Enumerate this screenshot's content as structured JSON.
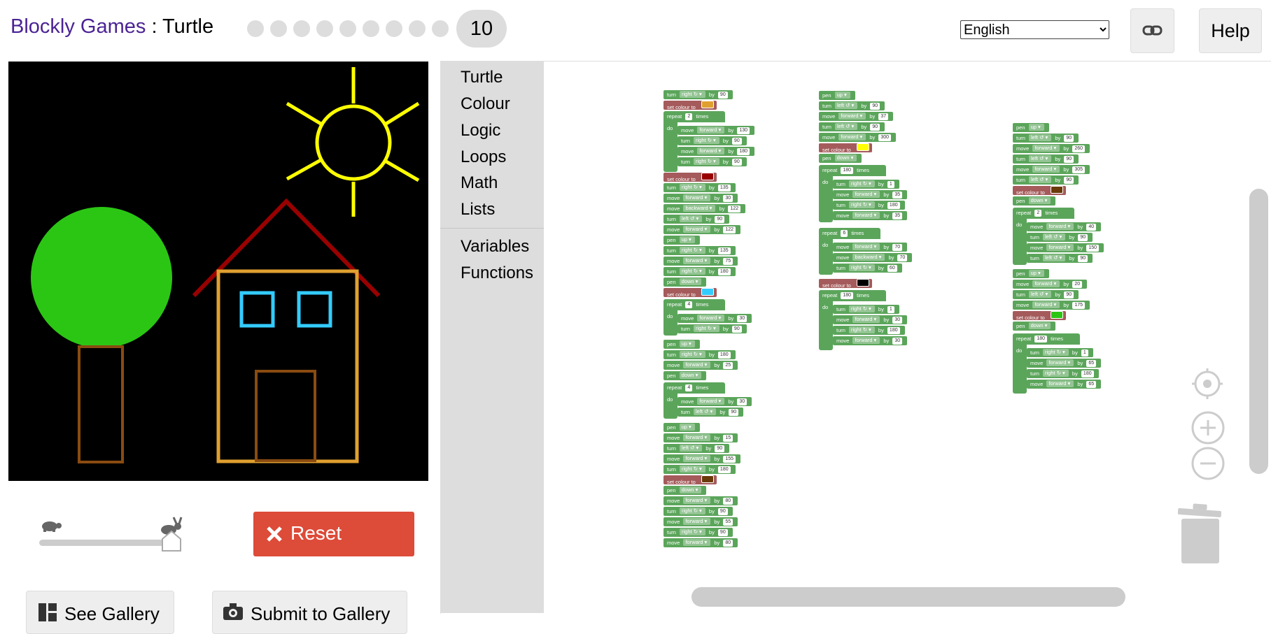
{
  "header": {
    "app_link": "Blockly Games",
    "separator": " : ",
    "page": "Turtle",
    "current_level": "10",
    "language": "English",
    "help": "Help"
  },
  "toolbox": {
    "categories": [
      "Turtle",
      "Colour",
      "Logic",
      "Loops",
      "Math",
      "Lists"
    ],
    "categories2": [
      "Variables",
      "Functions"
    ]
  },
  "controls": {
    "reset": "Reset",
    "see_gallery": "See Gallery",
    "submit_gallery": "Submit to Gallery"
  },
  "colors": {
    "accent": "#4b2394",
    "reset": "#dd4b39",
    "turtle_blocks": "#5ba55b",
    "colour_blocks": "#a55b5b",
    "tree": "#2bc614",
    "sun": "#ffff00",
    "roof": "#990000",
    "house": "#e0a030",
    "windows": "#33ccff",
    "trunk_door": "#8a4b10"
  },
  "icons": [
    "link-icon",
    "turtle-icon",
    "rabbit-icon",
    "close-icon",
    "gallery-icon",
    "camera-icon",
    "target-icon",
    "zoom-in-icon",
    "zoom-out-icon",
    "trash-icon"
  ],
  "speed": 1.0
}
